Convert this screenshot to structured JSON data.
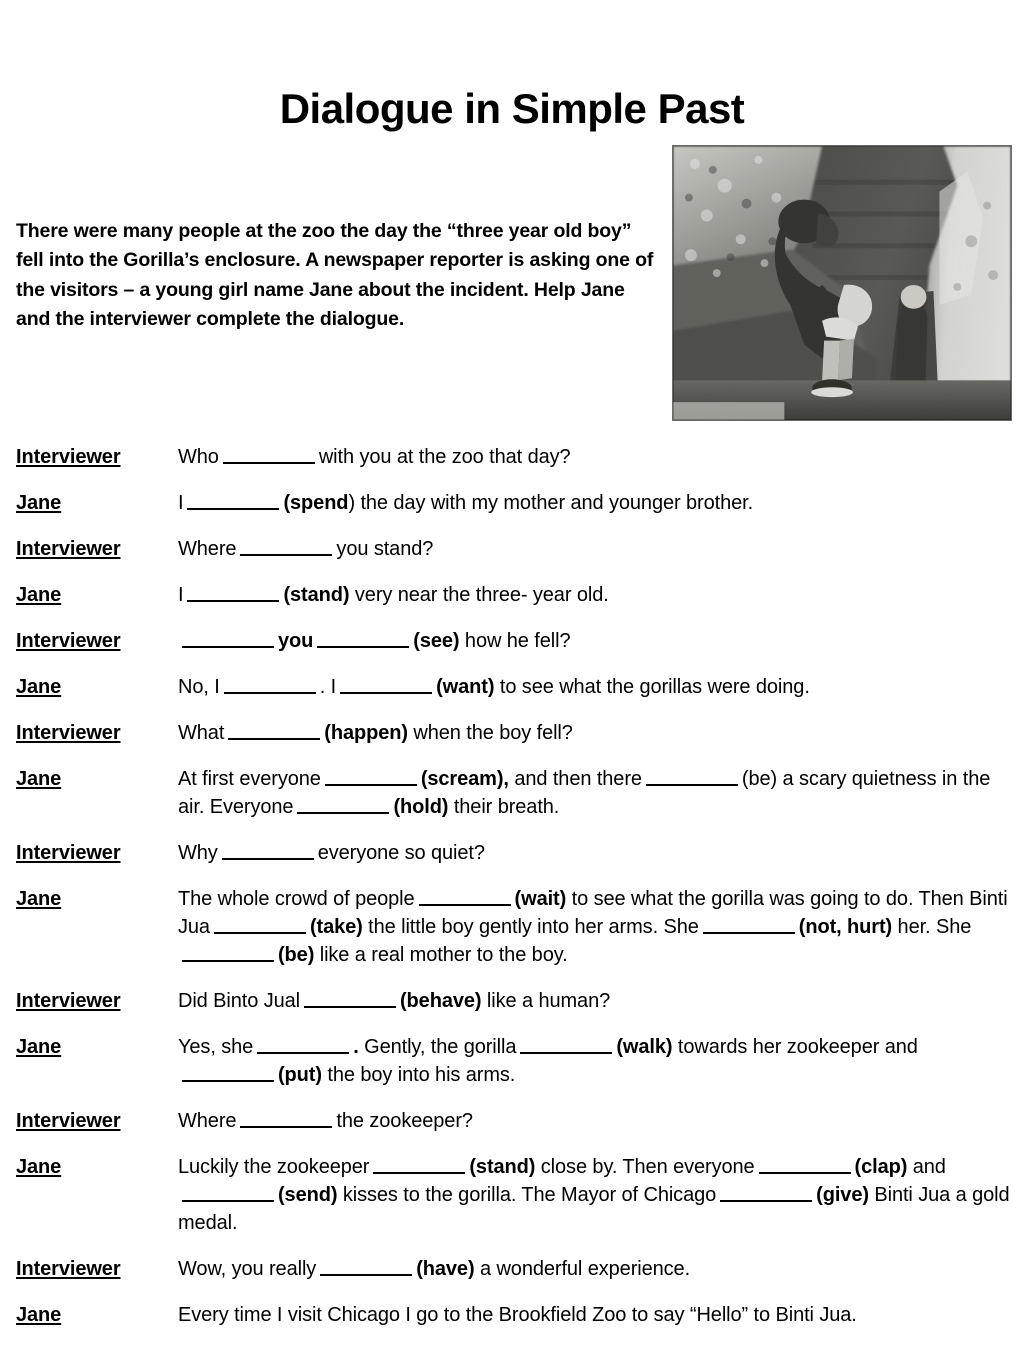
{
  "title": "Dialogue in Simple Past",
  "intro": "There were many people at the zoo the day the “three year old boy” fell into the Gorilla’s enclosure.  A newspaper reporter is asking one of the visitors – a young girl name Jane about the incident.  Help Jane and the interviewer complete the dialogue.",
  "photo": {
    "alt": "gorilla-photo",
    "description": "Grainy black and white photograph of a gorilla sitting on rocks in a zoo enclosure holding a small child"
  },
  "speakers": {
    "interviewer": "Interviewer",
    "jane": "Jane"
  },
  "colors": {
    "text": "#000000",
    "background": "#ffffff",
    "blank_rule": "#000000"
  },
  "dialogue": [
    {
      "speaker": "Interviewer",
      "parts": [
        {
          "t": "text",
          "v": "Who"
        },
        {
          "t": "blank"
        },
        {
          "t": "text",
          "v": "with you at the zoo that day?"
        }
      ]
    },
    {
      "speaker": "Jane",
      "parts": [
        {
          "t": "text",
          "v": "I"
        },
        {
          "t": "blank"
        },
        {
          "t": "bold",
          "v": "(spend"
        },
        {
          "t": "text",
          "v": ") the day with my mother and younger brother."
        }
      ]
    },
    {
      "speaker": "Interviewer",
      "parts": [
        {
          "t": "text",
          "v": "Where"
        },
        {
          "t": "blank"
        },
        {
          "t": "text",
          "v": "you stand?"
        }
      ]
    },
    {
      "speaker": "Jane",
      "parts": [
        {
          "t": "text",
          "v": "I"
        },
        {
          "t": "blank"
        },
        {
          "t": "bold",
          "v": "(stand)"
        },
        {
          "t": "text",
          "v": " very near the three- year old."
        }
      ]
    },
    {
      "speaker": "Interviewer",
      "parts": [
        {
          "t": "blank"
        },
        {
          "t": "bold",
          "v": "you"
        },
        {
          "t": "blank"
        },
        {
          "t": "bold",
          "v": "(see)"
        },
        {
          "t": "text",
          "v": " how he fell?"
        }
      ]
    },
    {
      "speaker": "Jane",
      "parts": [
        {
          "t": "text",
          "v": "No, I"
        },
        {
          "t": "blank"
        },
        {
          "t": "text",
          "v": ".  I"
        },
        {
          "t": "blank"
        },
        {
          "t": "bold",
          "v": "(want)"
        },
        {
          "t": "text",
          "v": " to see what the gorillas were doing."
        }
      ]
    },
    {
      "speaker": "Interviewer",
      "parts": [
        {
          "t": "text",
          "v": "What"
        },
        {
          "t": "blank"
        },
        {
          "t": "bold",
          "v": "(happen)"
        },
        {
          "t": "text",
          "v": " when the boy fell?"
        }
      ]
    },
    {
      "speaker": "Jane",
      "parts": [
        {
          "t": "text",
          "v": "At first everyone"
        },
        {
          "t": "blank"
        },
        {
          "t": "bold",
          "v": "(scream),"
        },
        {
          "t": "text",
          "v": " and then there"
        },
        {
          "t": "blank"
        },
        {
          "t": "text",
          "v": "(be) a scary quietness in the air.  Everyone"
        },
        {
          "t": "blank"
        },
        {
          "t": "bold",
          "v": "(hold)"
        },
        {
          "t": "text",
          "v": " their breath."
        }
      ]
    },
    {
      "speaker": "Interviewer",
      "parts": [
        {
          "t": "text",
          "v": "Why"
        },
        {
          "t": "blank"
        },
        {
          "t": "text",
          "v": "everyone so quiet?"
        }
      ]
    },
    {
      "speaker": "Jane",
      "parts": [
        {
          "t": "text",
          "v": "The whole crowd of people"
        },
        {
          "t": "blank"
        },
        {
          "t": "bold",
          "v": "(wait)"
        },
        {
          "t": "text",
          "v": " to see what the gorilla was going to do.  Then Binti Jua"
        },
        {
          "t": "blank"
        },
        {
          "t": "bold",
          "v": "(take)"
        },
        {
          "t": "text",
          "v": " the little boy gently into her arms.  She"
        },
        {
          "t": "blank"
        },
        {
          "t": "bold",
          "v": "(not, hurt)"
        },
        {
          "t": "text",
          "v": " her.  She"
        },
        {
          "t": "blank"
        },
        {
          "t": "bold",
          "v": "(be)"
        },
        {
          "t": "text",
          "v": " like a real mother to the boy."
        }
      ]
    },
    {
      "speaker": "Interviewer",
      "parts": [
        {
          "t": "text",
          "v": "Did Binto Jual"
        },
        {
          "t": "blank"
        },
        {
          "t": "bold",
          "v": "(behave)"
        },
        {
          "t": "text",
          "v": " like a human?"
        }
      ]
    },
    {
      "speaker": "Jane",
      "parts": [
        {
          "t": "text",
          "v": "Yes, she"
        },
        {
          "t": "blank"
        },
        {
          "t": "bold",
          "v": "."
        },
        {
          "t": "text",
          "v": "  Gently, the gorilla"
        },
        {
          "t": "blank"
        },
        {
          "t": "bold",
          "v": "(walk)"
        },
        {
          "t": "text",
          "v": " towards her zookeeper and"
        },
        {
          "t": "blank"
        },
        {
          "t": "bold",
          "v": "(put)"
        },
        {
          "t": "text",
          "v": " the boy into his arms."
        }
      ]
    },
    {
      "speaker": "Interviewer",
      "parts": [
        {
          "t": "text",
          "v": "Where"
        },
        {
          "t": "blank"
        },
        {
          "t": "text",
          "v": "the zookeeper?"
        }
      ]
    },
    {
      "speaker": "Jane",
      "parts": [
        {
          "t": "text",
          "v": "Luckily the zookeeper"
        },
        {
          "t": "blank"
        },
        {
          "t": "bold",
          "v": "(stand)"
        },
        {
          "t": "text",
          "v": " close by.  Then everyone"
        },
        {
          "t": "blank"
        },
        {
          "t": "bold",
          "v": "(clap)"
        },
        {
          "t": "text",
          "v": " and"
        },
        {
          "t": "blank"
        },
        {
          "t": "bold",
          "v": "(send)"
        },
        {
          "t": "text",
          "v": " kisses to the gorilla.  The Mayor of Chicago"
        },
        {
          "t": "blank"
        },
        {
          "t": "bold",
          "v": "(give)"
        },
        {
          "t": "text",
          "v": " Binti Jua a gold medal."
        }
      ]
    },
    {
      "speaker": "Interviewer",
      "parts": [
        {
          "t": "text",
          "v": "Wow, you really"
        },
        {
          "t": "blank"
        },
        {
          "t": "bold",
          "v": "(have)"
        },
        {
          "t": "text",
          "v": " a wonderful experience."
        }
      ]
    },
    {
      "speaker": "Jane",
      "parts": [
        {
          "t": "text",
          "v": "Every time I visit Chicago I go to the Brookfield Zoo to say “Hello” to Binti Jua."
        }
      ]
    }
  ]
}
